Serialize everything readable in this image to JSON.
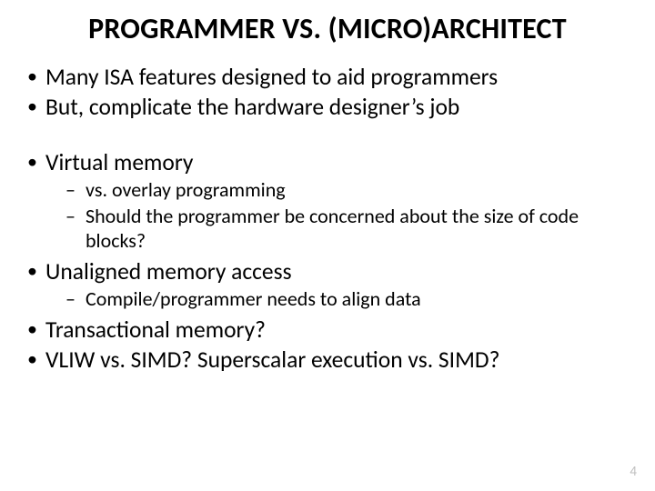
{
  "title": "PROGRAMMER VS. (MICRO)ARCHITECT",
  "bullets": {
    "b1": "Many ISA features designed to aid programmers",
    "b2": "But, complicate the hardware designer’s job",
    "b3": "Virtual memory",
    "b3s1": "vs. overlay programming",
    "b3s2": "Should the programmer be concerned about the size of code blocks?",
    "b4": "Unaligned memory access",
    "b4s1": "Compile/programmer needs to align data",
    "b5": "Transactional memory?",
    "b6": "VLIW vs. SIMD? Superscalar execution vs. SIMD?"
  },
  "page_number": "4"
}
